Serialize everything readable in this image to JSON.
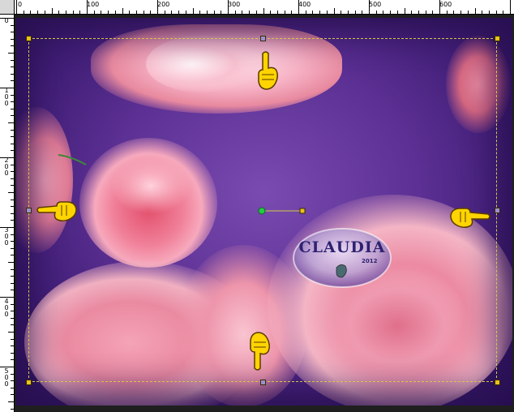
{
  "rulers": {
    "top_labels": [
      "0",
      "100",
      "200",
      "300",
      "400",
      "500",
      "600"
    ],
    "left_labels": [
      "0",
      "100",
      "200",
      "300",
      "400",
      "500"
    ]
  },
  "watermark": {
    "text": "CLAUDIA",
    "sub": "2012"
  },
  "colors": {
    "background": "#5b2f93",
    "selection": "#d2c84a",
    "handle_corner": "#e7c21b",
    "handle_mid": "#9a8fd0",
    "pointer": "#ffd400",
    "rotation_handle": "#22cc44"
  },
  "icons": {
    "top": "hand-pointing-up-icon",
    "left": "hand-pointing-left-icon",
    "right": "hand-pointing-right-icon",
    "bottom": "hand-pointing-down-icon"
  }
}
